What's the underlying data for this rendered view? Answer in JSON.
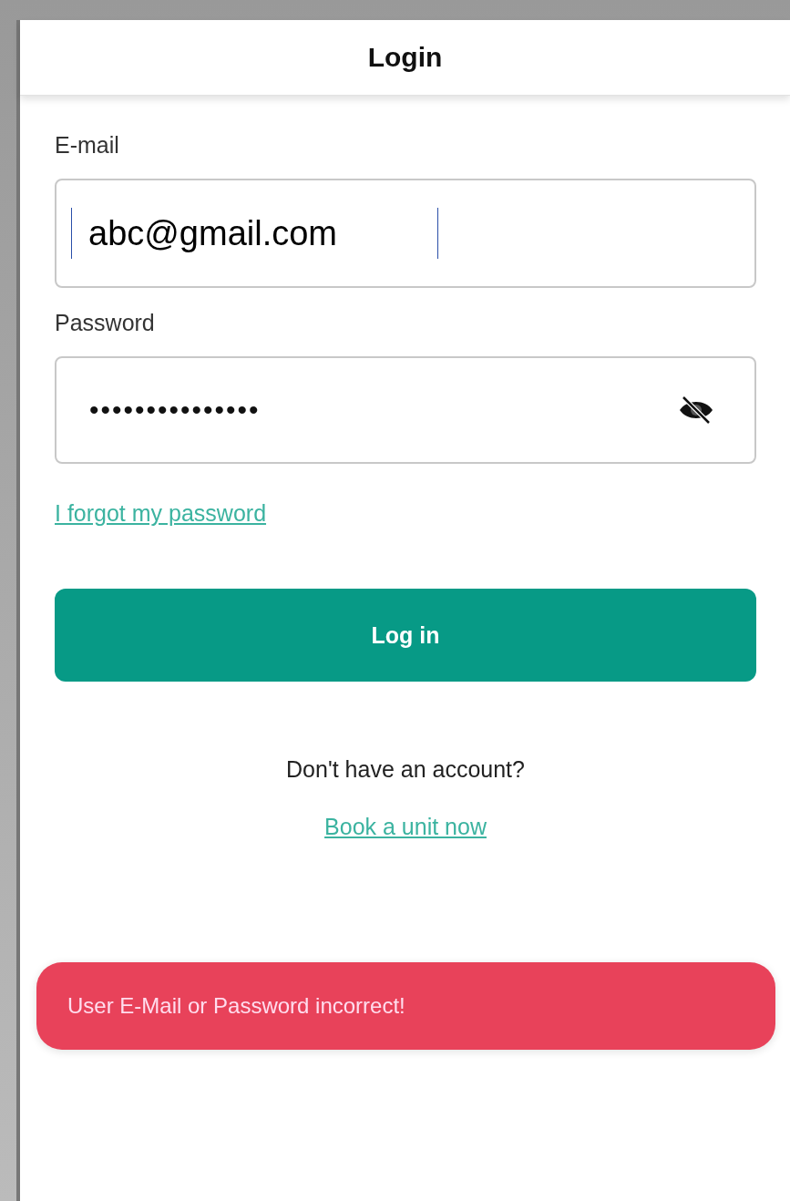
{
  "header": {
    "title": "Login"
  },
  "email": {
    "label": "E-mail",
    "value": "abc@gmail.com"
  },
  "password": {
    "label": "Password",
    "value": "•••••••••••••••",
    "visible": false
  },
  "forgot_link": "I forgot my password",
  "login_button": "Log in",
  "signup_prompt": "Don't have an account?",
  "signup_link": "Book a unit now",
  "toast": {
    "message": "User E-Mail or Password incorrect!",
    "kind": "error"
  }
}
